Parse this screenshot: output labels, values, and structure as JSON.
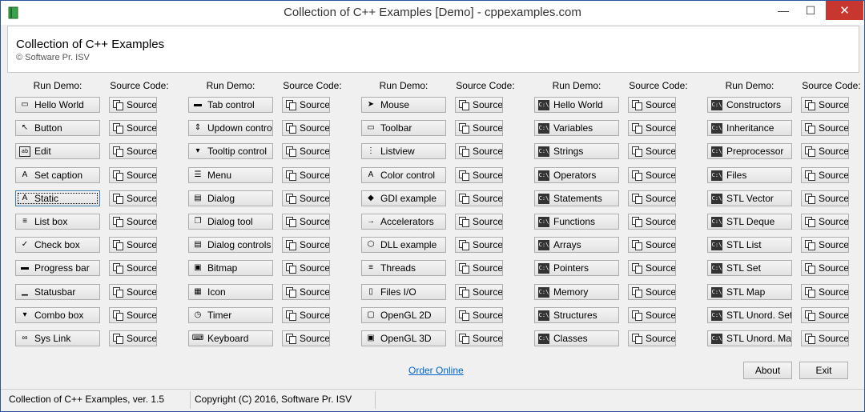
{
  "window": {
    "title": "Collection of C++ Examples [Demo]  -  cppexamples.com",
    "min_label": "—",
    "max_label": "☐",
    "close_label": "✕"
  },
  "header": {
    "title": "Collection of C++ Examples",
    "subtitle": "© Software Pr. ISV"
  },
  "labels": {
    "run_demo": "Run Demo:",
    "source_code": "Source Code:",
    "source": "Source"
  },
  "columns": [
    {
      "items": [
        {
          "label": "Hello World",
          "icon": "window-icon"
        },
        {
          "label": "Button",
          "icon": "button-icon"
        },
        {
          "label": "Edit",
          "icon": "edit-icon"
        },
        {
          "label": "Set caption",
          "icon": "caption-icon"
        },
        {
          "label": "Static",
          "icon": "static-text-icon"
        },
        {
          "label": "List box",
          "icon": "listbox-icon"
        },
        {
          "label": "Check box",
          "icon": "checkbox-icon"
        },
        {
          "label": "Progress bar",
          "icon": "progress-icon"
        },
        {
          "label": "Statusbar",
          "icon": "statusbar-icon"
        },
        {
          "label": "Combo box",
          "icon": "combobox-icon"
        },
        {
          "label": "Sys Link",
          "icon": "link-icon"
        }
      ]
    },
    {
      "items": [
        {
          "label": "Tab control",
          "icon": "tab-icon"
        },
        {
          "label": "Updown control",
          "icon": "updown-icon"
        },
        {
          "label": "Tooltip control",
          "icon": "tooltip-icon"
        },
        {
          "label": "Menu",
          "icon": "menu-icon"
        },
        {
          "label": "Dialog",
          "icon": "dialog-icon"
        },
        {
          "label": "Dialog tool",
          "icon": "dialog-tool-icon"
        },
        {
          "label": "Dialog controls",
          "icon": "dialog-controls-icon"
        },
        {
          "label": "Bitmap",
          "icon": "bitmap-icon"
        },
        {
          "label": "Icon",
          "icon": "icon-icon"
        },
        {
          "label": "Timer",
          "icon": "timer-icon"
        },
        {
          "label": "Keyboard",
          "icon": "keyboard-icon"
        }
      ]
    },
    {
      "items": [
        {
          "label": "Mouse",
          "icon": "mouse-icon"
        },
        {
          "label": "Toolbar",
          "icon": "toolbar-icon"
        },
        {
          "label": "Listview",
          "icon": "listview-icon"
        },
        {
          "label": "Color control",
          "icon": "color-icon"
        },
        {
          "label": "GDI example",
          "icon": "gdi-icon"
        },
        {
          "label": "Accelerators",
          "icon": "accelerator-icon"
        },
        {
          "label": "DLL example",
          "icon": "dll-icon"
        },
        {
          "label": "Threads",
          "icon": "threads-icon"
        },
        {
          "label": "Files I/O",
          "icon": "file-icon"
        },
        {
          "label": "OpenGL 2D",
          "icon": "opengl-2d-icon"
        },
        {
          "label": "OpenGL 3D",
          "icon": "opengl-3d-icon"
        }
      ]
    },
    {
      "items": [
        {
          "label": "Hello World",
          "icon": "console-icon"
        },
        {
          "label": "Variables",
          "icon": "console-icon"
        },
        {
          "label": "Strings",
          "icon": "console-icon"
        },
        {
          "label": "Operators",
          "icon": "console-icon"
        },
        {
          "label": "Statements",
          "icon": "console-icon"
        },
        {
          "label": "Functions",
          "icon": "console-icon"
        },
        {
          "label": "Arrays",
          "icon": "console-icon"
        },
        {
          "label": "Pointers",
          "icon": "console-icon"
        },
        {
          "label": "Memory",
          "icon": "console-icon"
        },
        {
          "label": "Structures",
          "icon": "console-icon"
        },
        {
          "label": "Classes",
          "icon": "console-icon"
        }
      ]
    },
    {
      "items": [
        {
          "label": "Constructors",
          "icon": "console-icon"
        },
        {
          "label": "Inheritance",
          "icon": "console-icon"
        },
        {
          "label": "Preprocessor",
          "icon": "console-icon"
        },
        {
          "label": "Files",
          "icon": "console-icon"
        },
        {
          "label": "STL Vector",
          "icon": "console-icon"
        },
        {
          "label": "STL Deque",
          "icon": "console-icon"
        },
        {
          "label": "STL List",
          "icon": "console-icon"
        },
        {
          "label": "STL Set",
          "icon": "console-icon"
        },
        {
          "label": "STL Map",
          "icon": "console-icon"
        },
        {
          "label": "STL Unord. Set",
          "icon": "console-icon"
        },
        {
          "label": "STL Unord. Map",
          "icon": "console-icon"
        }
      ]
    }
  ],
  "footer": {
    "order_online": "Order Online",
    "about": "About",
    "exit": "Exit"
  },
  "statusbar": {
    "version": "Collection of C++ Examples, ver. 1.5",
    "copyright": "Copyright (C) 2016, Software Pr. ISV",
    "empty": ""
  },
  "colors": {
    "accent": "#2b579a",
    "close": "#c7372f",
    "link": "#0066cc"
  }
}
